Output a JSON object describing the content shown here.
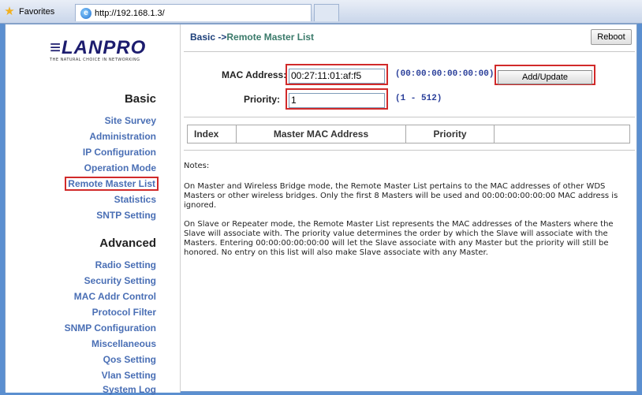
{
  "browser": {
    "favorites_label": "Favorites",
    "tab_url": "http://192.168.1.3/"
  },
  "sidebar": {
    "logo_text": "LANPRO",
    "logo_tagline": "THE NATURAL CHOICE IN NETWORKING",
    "basic_title": "Basic",
    "basic_items": [
      {
        "label": "Site Survey"
      },
      {
        "label": "Administration"
      },
      {
        "label": "IP Configuration"
      },
      {
        "label": "Operation Mode"
      },
      {
        "label": "Remote Master List"
      },
      {
        "label": "Statistics"
      },
      {
        "label": "SNTP Setting"
      }
    ],
    "advanced_title": "Advanced",
    "advanced_items": [
      {
        "label": "Radio Setting"
      },
      {
        "label": "Security Setting"
      },
      {
        "label": "MAC Addr Control"
      },
      {
        "label": "Protocol Filter"
      },
      {
        "label": "SNMP Configuration"
      },
      {
        "label": "Miscellaneous"
      },
      {
        "label": "Qos Setting"
      },
      {
        "label": "Vlan Setting"
      },
      {
        "label": "System Log"
      }
    ]
  },
  "main": {
    "breadcrumb_prefix": "Basic ->",
    "breadcrumb_current": "Remote Master List",
    "reboot_label": "Reboot",
    "mac_label": "MAC Address:",
    "mac_value": "00:27:11:01:af:f5",
    "mac_hint": "(00:00:00:00:00:00)",
    "priority_label": "Priority:",
    "priority_value": "1",
    "priority_hint": "(1 - 512)",
    "add_update_label": "Add/Update",
    "table_headers": [
      "Index",
      "Master MAC Address",
      "Priority",
      ""
    ],
    "notes_title": "Notes:",
    "notes": [
      "On Master and Wireless Bridge mode, the Remote Master List pertains to the MAC addresses of other WDS Masters or other wireless bridges. Only the first 8 Masters will be used and 00:00:00:00:00:00 MAC address is ignored.",
      "On Slave or Repeater mode, the Remote Master List represents the MAC addresses of the Masters where the Slave will associate with. The priority value determines the order by which the Slave will associate with the Masters. Entering 00:00:00:00:00:00 will let the Slave associate with any Master but the priority will still be honored. No entry on this list will also make Slave associate with any Master."
    ]
  },
  "colors": {
    "highlight_border": "#d12a2a",
    "nav_link": "#4a6fb5",
    "hint_text": "#2a3f9a"
  }
}
